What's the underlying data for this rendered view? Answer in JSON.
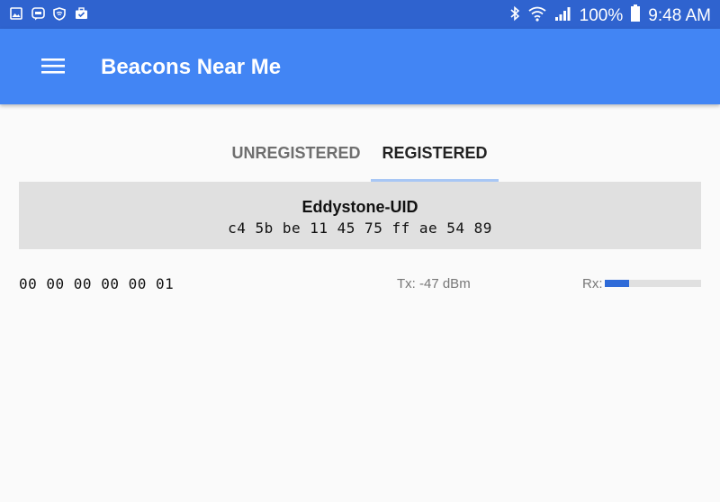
{
  "status_bar": {
    "battery_text": "100%",
    "time": "9:48 AM",
    "left_icons": [
      "gallery-icon",
      "message-icon",
      "vpn-shield-icon",
      "briefcase-icon"
    ],
    "right_icons": [
      "bluetooth-icon",
      "wifi-icon",
      "signal-icon",
      "battery-icon"
    ]
  },
  "app_bar": {
    "title": "Beacons Near Me",
    "menu_icon": "hamburger-menu-icon"
  },
  "tabs": {
    "unregistered": "UNREGISTERED",
    "registered": "REGISTERED",
    "selected": "registered"
  },
  "beacon": {
    "type": "Eddystone-UID",
    "namespace": "c4 5b be 11 45 75 ff ae 54 89",
    "instance": "00 00 00 00 00 01",
    "tx": "Tx: -47 dBm",
    "rx_label": "Rx:",
    "rx_fraction": 0.25
  },
  "colors": {
    "status_bar": "#2f63cf",
    "app_bar": "#4285f4",
    "tab_indicator": "#a8c7f5",
    "rx_fill": "#2f6bd8",
    "header_bg": "#e0e0e0"
  }
}
